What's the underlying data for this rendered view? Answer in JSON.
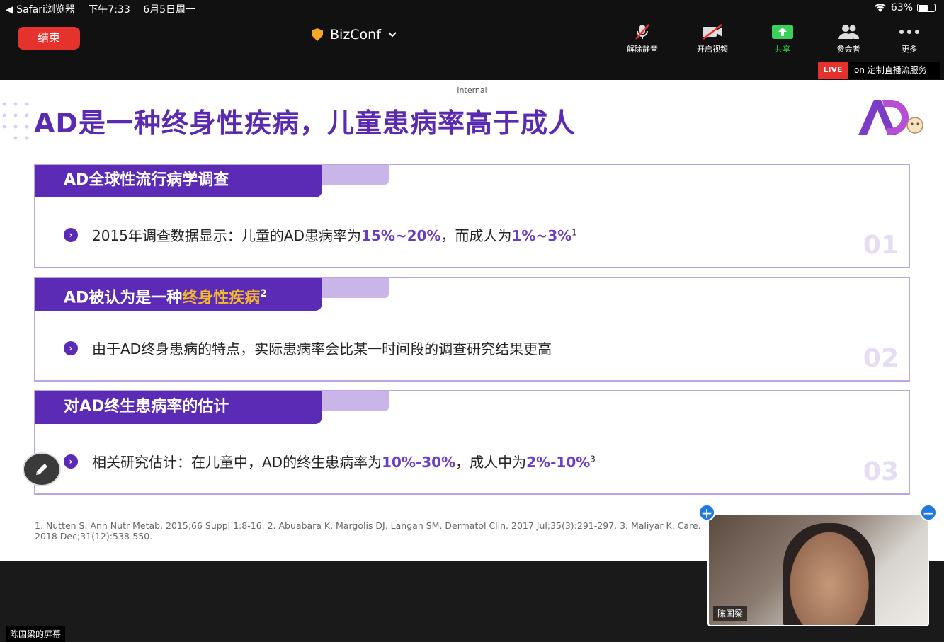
{
  "statusbar": {
    "app": "◀ Safari浏览器",
    "time": "下午7:33",
    "date": "6月5日周一",
    "battery": "63%",
    "battery_level": 0.63
  },
  "meeting": {
    "end_label": "结束",
    "title": "BizConf",
    "tools": [
      {
        "label": "解除静音",
        "icon": "mic-muted-icon"
      },
      {
        "label": "开启视频",
        "icon": "camera-off-icon"
      },
      {
        "label": "共享",
        "icon": "share-icon"
      },
      {
        "label": "参会者",
        "icon": "participants-icon"
      },
      {
        "label": "更多",
        "icon": "more-icon"
      }
    ],
    "live_badge": "LIVE",
    "live_text": "on 定制直播流服务",
    "screen_label": "陈国梁的屏幕"
  },
  "slide": {
    "internal": "Internal",
    "title": "AD是一种终身性疾病，儿童患病率高于成人",
    "sections": [
      {
        "heading": "AD全球性流行病学调查",
        "text_parts": [
          "2015年调查数据显示：儿童的AD患病率为",
          "15%~20%",
          "，而成人为",
          "1%~3%",
          "1"
        ],
        "number": "01"
      },
      {
        "heading_pre": "AD被认为是一种",
        "heading_hl": "终身性疾病",
        "heading_sup": "2",
        "text": "由于AD终身患病的特点，实际患病率会比某一时间段的调查研究结果更高",
        "number": "02"
      },
      {
        "heading": "对AD终生患病率的估计",
        "text_parts": [
          "相关研究估计：在儿童中，AD的终生患病率为",
          "10%-30%",
          "，成人中为",
          "2%-10%",
          "3"
        ],
        "number": "03"
      }
    ],
    "references": "1. Nutten S. Ann Nutr Metab. 2015;66 Suppl 1:8-16. 2. Abuabara K, Margolis DJ, Langan SM. Dermatol Clin. 2017 Jul;35(3):291-297. 3. Maliyar K, Care. 2018 Dec;31(12):538-550."
  },
  "video": {
    "name": "陈国梁",
    "add_label": "+",
    "minimize_label": "−"
  },
  "colors": {
    "brand": "#5b2bb5",
    "highlight": "#f5b92d",
    "end": "#e5322d",
    "share": "#3ad15a"
  }
}
